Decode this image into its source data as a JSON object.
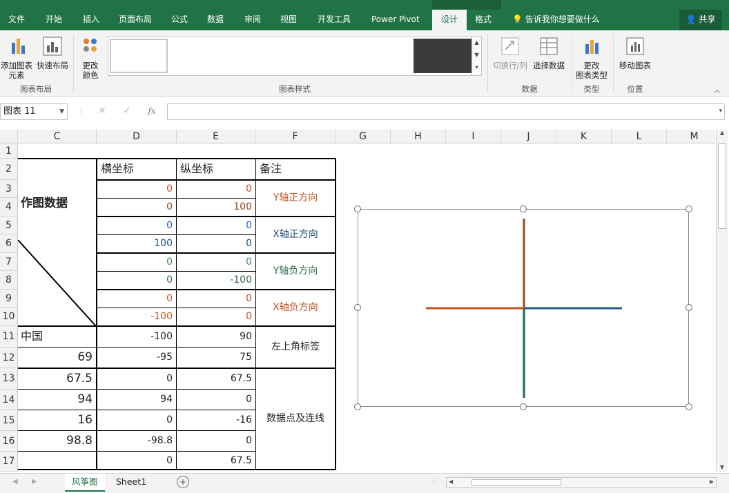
{
  "ribbon_tabs": [
    "文件",
    "开始",
    "插入",
    "页面布局",
    "公式",
    "数据",
    "审阅",
    "视图",
    "开发工具",
    "Power Pivot",
    "设计",
    "格式"
  ],
  "active_tab": "设计",
  "tell_me": "告诉我你想要做什么",
  "share": "共享",
  "ribbon": {
    "add_element": "添加图表",
    "add_element2": "元素",
    "quick_layout": "快速布局",
    "change_color": "更改",
    "change_color2": "颜色",
    "group_layout": "图表布局",
    "group_styles": "图表样式",
    "switch_row_col": "切换行/列",
    "select_data": "选择数据",
    "group_data": "数据",
    "change_type": "更改",
    "change_type2": "图表类型",
    "group_type": "类型",
    "move_chart": "移动图表",
    "group_location": "位置"
  },
  "name_box": "图表 11",
  "formula_icons": {
    "cancel": "✕",
    "enter": "✓",
    "fx": "fx"
  },
  "columns": [
    "C",
    "D",
    "E",
    "F",
    "G",
    "H",
    "I",
    "J",
    "K",
    "L",
    "M"
  ],
  "rows": [
    "1",
    "2",
    "3",
    "4",
    "5",
    "6",
    "7",
    "8",
    "9",
    "10",
    "11",
    "12",
    "13",
    "14",
    "15",
    "16",
    "17"
  ],
  "table": {
    "header_d": "横坐标",
    "header_e": "纵坐标",
    "header_f": "备注",
    "title_c": "作图数据",
    "r3": {
      "d": "0",
      "e": "0"
    },
    "r4": {
      "d": "0",
      "e": "100"
    },
    "r5": {
      "d": "0",
      "e": "0"
    },
    "r6": {
      "d": "100",
      "e": "0"
    },
    "r7": {
      "d": "0",
      "e": "0"
    },
    "r8": {
      "d": "0",
      "e": "-100"
    },
    "r9": {
      "d": "0",
      "e": "0"
    },
    "r10": {
      "d": "-100",
      "e": "0"
    },
    "note_y_pos": "Y轴正方向",
    "note_x_pos": "X轴正方向",
    "note_y_neg": "Y轴负方向",
    "note_x_neg": "X轴负方向",
    "r11": {
      "c": "中国",
      "d": "-100",
      "e": "90"
    },
    "r12": {
      "c": "69",
      "d": "-95",
      "e": "75"
    },
    "note_label": "左上角标签",
    "r13": {
      "c": "67.5",
      "d": "0",
      "e": "67.5"
    },
    "r14": {
      "c": "94",
      "d": "94",
      "e": "0"
    },
    "r15": {
      "c": "16",
      "d": "0",
      "e": "-16"
    },
    "r16": {
      "c": "98.8",
      "d": "-98.8",
      "e": "0"
    },
    "r17": {
      "c": "",
      "d": "0",
      "e": "67.5"
    },
    "note_points": "数据点及连线"
  },
  "colors": {
    "brand": "#217346",
    "y_pos": "#8b4513",
    "x_pos": "#1f4e79",
    "y_neg": "#2e6b3e",
    "x_neg": "#c0501e"
  },
  "chart_data": {
    "type": "scatter",
    "series": [
      {
        "x": [
          0,
          0
        ],
        "y": [
          0,
          100
        ],
        "color": "#9c4a1a"
      },
      {
        "x": [
          0,
          100
        ],
        "y": [
          0,
          0
        ],
        "color": "#1f5a96"
      },
      {
        "x": [
          0,
          0
        ],
        "y": [
          0,
          -100
        ],
        "color": "#1e6b42"
      },
      {
        "x": [
          0,
          -100
        ],
        "y": [
          0,
          0
        ],
        "color": "#c0501e"
      }
    ],
    "xlim": [
      -100,
      100
    ],
    "ylim": [
      -100,
      100
    ],
    "grid": false,
    "axes_visible": false
  },
  "sheets": [
    "风筝图",
    "Sheet1"
  ],
  "active_sheet": "风筝图"
}
